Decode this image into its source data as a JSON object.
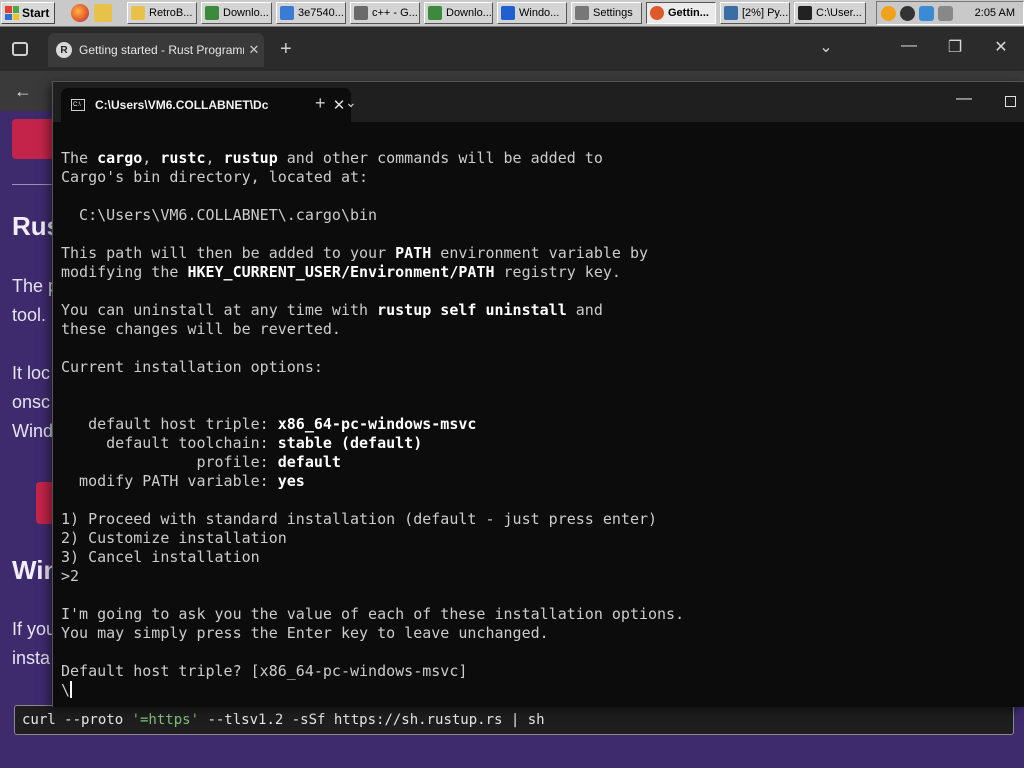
{
  "taskbar": {
    "start_label": "Start",
    "tasks": [
      {
        "label": "RetroB...",
        "icon": "folder-icon",
        "color": "#e8c14a"
      },
      {
        "label": "Downlo...",
        "icon": "download-icon",
        "color": "#3c8a3c"
      },
      {
        "label": "3e7540...",
        "icon": "image-icon",
        "color": "#3b7bd4"
      },
      {
        "label": "c++ - G...",
        "icon": "browser-icon",
        "color": "#6a6a6a"
      },
      {
        "label": "Downlo...",
        "icon": "download-icon",
        "color": "#3c8a3c"
      },
      {
        "label": "Windo...",
        "icon": "shield-icon",
        "color": "#1f5fd0"
      },
      {
        "label": "Settings",
        "icon": "gear-icon",
        "color": "#777777"
      },
      {
        "label": "Gettin...",
        "icon": "firefox-icon",
        "color": "#e0592a"
      },
      {
        "label": "[2%] Py...",
        "icon": "python-icon",
        "color": "#3b6ea5"
      },
      {
        "label": "C:\\User...",
        "icon": "terminal-icon",
        "color": "#222222"
      }
    ],
    "clock": "2:05 AM"
  },
  "browser": {
    "tab_title": "Getting started - Rust Programming Language",
    "page": {
      "heading_1": "Rus",
      "para_1_line_1": "The p",
      "para_1_line_2": "tool.",
      "para_2_line_1": "It loc",
      "para_2_line_2": "onsc",
      "para_2_line_3": "Wind",
      "heading_2": "Win",
      "para_3_line_1": "If you",
      "para_3_line_2": "insta"
    },
    "command_strip": {
      "before": "curl --proto ",
      "quoted": "'=https'",
      "after": " --tlsv1.2 -sSf https://sh.rustup.rs | sh"
    }
  },
  "terminal": {
    "tab_title": "C:\\Users\\VM6.COLLABNET\\Dc",
    "lines": [
      {
        "segments": [
          {
            "t": "The "
          },
          {
            "t": "cargo",
            "b": true
          },
          {
            "t": ", "
          },
          {
            "t": "rustc",
            "b": true
          },
          {
            "t": ", "
          },
          {
            "t": "rustup",
            "b": true
          },
          {
            "t": " and other commands will be added to"
          }
        ]
      },
      {
        "segments": [
          {
            "t": "Cargo's bin directory, located at:"
          }
        ]
      },
      {
        "segments": [
          {
            "t": ""
          }
        ]
      },
      {
        "segments": [
          {
            "t": "  C:\\Users\\VM6.COLLABNET\\.cargo\\bin"
          }
        ]
      },
      {
        "segments": [
          {
            "t": ""
          }
        ]
      },
      {
        "segments": [
          {
            "t": "This path will then be added to your "
          },
          {
            "t": "PATH",
            "b": true
          },
          {
            "t": " environment variable by"
          }
        ]
      },
      {
        "segments": [
          {
            "t": "modifying the "
          },
          {
            "t": "HKEY_CURRENT_USER/Environment/PATH",
            "b": true
          },
          {
            "t": " registry key."
          }
        ]
      },
      {
        "segments": [
          {
            "t": ""
          }
        ]
      },
      {
        "segments": [
          {
            "t": "You can uninstall at any time with "
          },
          {
            "t": "rustup self uninstall",
            "b": true
          },
          {
            "t": " and"
          }
        ]
      },
      {
        "segments": [
          {
            "t": "these changes will be reverted."
          }
        ]
      },
      {
        "segments": [
          {
            "t": ""
          }
        ]
      },
      {
        "segments": [
          {
            "t": "Current installation options:"
          }
        ]
      },
      {
        "segments": [
          {
            "t": ""
          }
        ]
      },
      {
        "segments": [
          {
            "t": ""
          }
        ]
      },
      {
        "segments": [
          {
            "t": "   default host triple: "
          },
          {
            "t": "x86_64-pc-windows-msvc",
            "b": true
          }
        ]
      },
      {
        "segments": [
          {
            "t": "     default toolchain: "
          },
          {
            "t": "stable (default)",
            "b": true
          }
        ]
      },
      {
        "segments": [
          {
            "t": "               profile: "
          },
          {
            "t": "default",
            "b": true
          }
        ]
      },
      {
        "segments": [
          {
            "t": "  modify PATH variable: "
          },
          {
            "t": "yes",
            "b": true
          }
        ]
      },
      {
        "segments": [
          {
            "t": ""
          }
        ]
      },
      {
        "segments": [
          {
            "t": "1) Proceed with standard installation (default - just press enter)"
          }
        ]
      },
      {
        "segments": [
          {
            "t": "2) Customize installation"
          }
        ]
      },
      {
        "segments": [
          {
            "t": "3) Cancel installation"
          }
        ]
      },
      {
        "segments": [
          {
            "t": ">2"
          }
        ]
      },
      {
        "segments": [
          {
            "t": ""
          }
        ]
      },
      {
        "segments": [
          {
            "t": "I'm going to ask you the value of each of these installation options."
          }
        ]
      },
      {
        "segments": [
          {
            "t": "You may simply press the Enter key to leave unchanged."
          }
        ]
      },
      {
        "segments": [
          {
            "t": ""
          }
        ]
      },
      {
        "segments": [
          {
            "t": "Default host triple? [x86_64-pc-windows-msvc]"
          }
        ]
      }
    ],
    "input_line": "\\"
  }
}
